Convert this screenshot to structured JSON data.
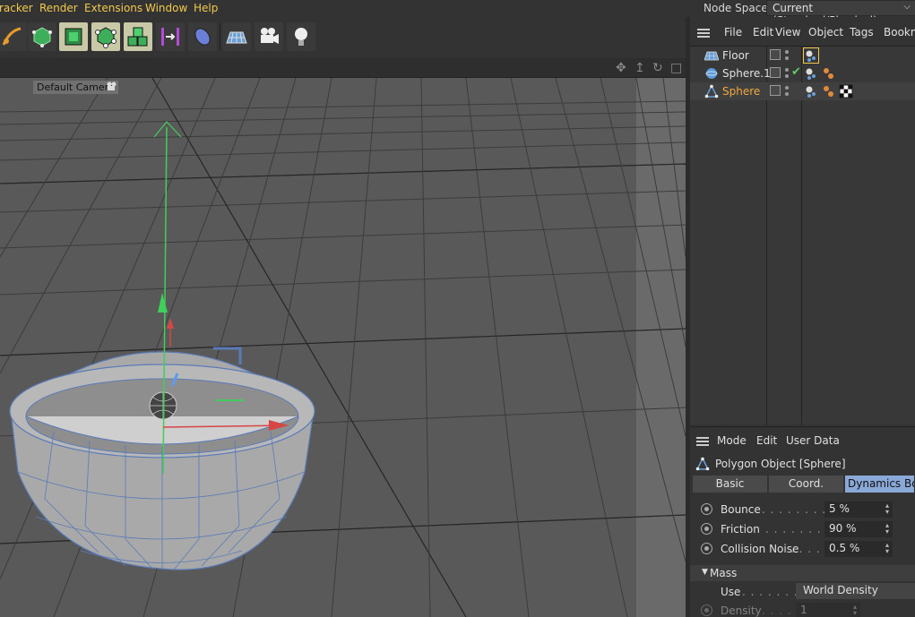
{
  "menubar": {
    "items": [
      "racker",
      "Render",
      "Extensions",
      "Window",
      "Help"
    ],
    "node_space_label": "Node Space:",
    "node_space_value": "Current (Standard/Physical)"
  },
  "toolbar": {
    "buttons": [
      {
        "icon": "pen-spline-icon",
        "active": false
      },
      {
        "icon": "generator-cube-icon",
        "active": false
      },
      {
        "icon": "subdivision-cube-icon",
        "active": true
      },
      {
        "icon": "deformer-cube-icon",
        "active": true
      },
      {
        "icon": "mograph-cloner-icon",
        "active": true
      },
      {
        "icon": "field-icon",
        "active": false
      },
      {
        "icon": "effector-icon",
        "active": false
      },
      {
        "icon": "floor-icon",
        "active": false
      },
      {
        "icon": "camera-icon",
        "active": false
      },
      {
        "icon": "light-icon",
        "active": false
      }
    ]
  },
  "viewport": {
    "camera_label": "Default Camera",
    "nav_icons": [
      "move-view-icon",
      "zoom-view-icon",
      "rotate-view-icon",
      "maximize-view-icon"
    ]
  },
  "object_manager": {
    "menu": [
      "File",
      "Edit",
      "View",
      "Object",
      "Tags",
      "Bookm"
    ],
    "objects": [
      {
        "name": "Floor",
        "icon": "floor-icon",
        "selected": false,
        "checked": false,
        "tags": [
          "rigid-body-tag-icon"
        ]
      },
      {
        "name": "Sphere.1",
        "icon": "sphere-icon",
        "selected": false,
        "checked": true,
        "tags": [
          "rigid-body-tag-icon",
          "material-tag-icon"
        ]
      },
      {
        "name": "Sphere",
        "icon": "polygon-icon",
        "selected": true,
        "checked": false,
        "tags": [
          "rigid-body-tag-icon",
          "material-tag-icon",
          "checker-tag-icon"
        ]
      }
    ]
  },
  "attribute_manager": {
    "menu": [
      "Mode",
      "Edit",
      "User Data"
    ],
    "title": "Polygon Object [Sphere]",
    "tabs": [
      {
        "label": "Basic",
        "active": false
      },
      {
        "label": "Coord.",
        "active": false
      },
      {
        "label": "Dynamics Body",
        "active": true
      }
    ],
    "properties": [
      {
        "label": "Bounce",
        "dots": ". . . . . . . . . . .",
        "value": "5 %"
      },
      {
        "label": "Friction",
        "dots": ". . . . . . . . . .",
        "value": "90 %"
      },
      {
        "label": "Collision Noise",
        "dots": ". . . . .",
        "value": "0.5 %"
      }
    ],
    "group_label": "Mass",
    "use_label": "Use",
    "use_dots": ". . . . . . . .",
    "use_value": "World Density",
    "density_label": "Density",
    "density_dots": ". . . . . . .",
    "density_value": "1"
  },
  "colors": {
    "menu_accent": "#f2c94c",
    "selected_object": "#f2a93b",
    "active_tab": "#8aa9d8",
    "viewport_bg": "#5a5a5a"
  }
}
